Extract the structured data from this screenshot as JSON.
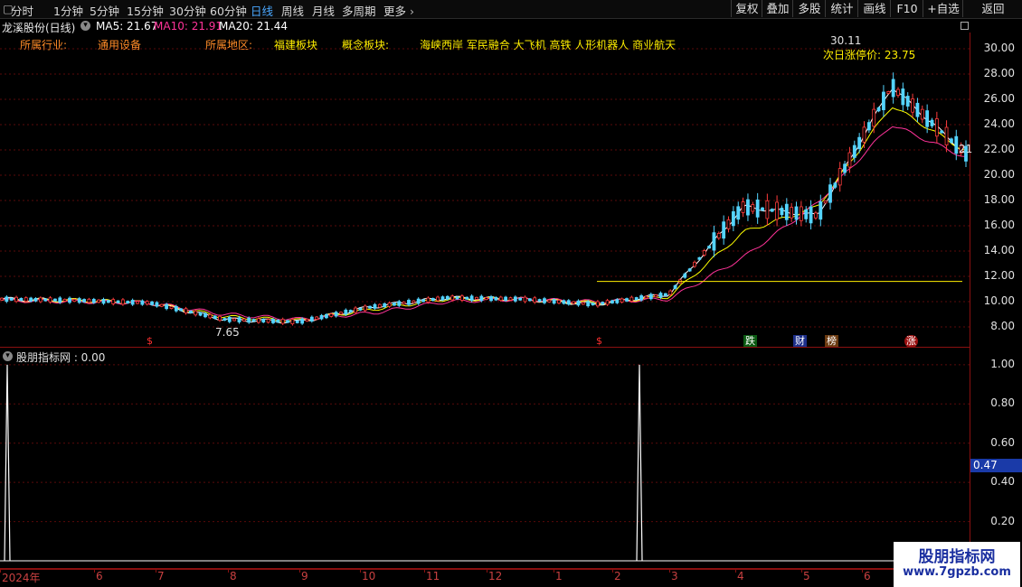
{
  "toolbar": {
    "tabs": [
      "分时",
      "1分钟",
      "5分钟",
      "15分钟",
      "30分钟",
      "60分钟",
      "日线",
      "周线",
      "月线",
      "多周期",
      "更多"
    ],
    "active_tab": "日线",
    "right_buttons": [
      "复权",
      "叠加",
      "多股",
      "统计",
      "画线",
      "F10",
      "+自选",
      "返回"
    ]
  },
  "stock": {
    "name": "龙溪股份(日线)",
    "ma5": "MA5: 21.67",
    "ma10": "MA10: 21.91",
    "ma20": "MA20: 21.44"
  },
  "info": {
    "industry_label": "所属行业:",
    "industry_value": "通用设备",
    "region_label": "所属地区:",
    "region_value": "福建板块",
    "concept_label": "概念板块:",
    "concept_value": "海峡西岸 军民融合 大飞机 高铁 人形机器人 商业航天"
  },
  "annotations": {
    "high": "30.11",
    "limit_up": "次日涨停价: 23.75",
    "low": "7.65",
    "last": "21"
  },
  "price_axis": [
    "30.00",
    "28.00",
    "26.00",
    "24.00",
    "22.00",
    "20.00",
    "18.00",
    "16.00",
    "14.00",
    "12.00",
    "10.00",
    "8.00"
  ],
  "markers": [
    "$",
    "$",
    "跌",
    "财",
    "榜",
    "涨"
  ],
  "indicator": {
    "title": "股朋指标网 : 0.00",
    "axis": [
      "1.00",
      "0.80",
      "0.60",
      "0.40",
      "0.20"
    ],
    "current": "0.47"
  },
  "date_axis": [
    "2024年",
    "6",
    "7",
    "8",
    "9",
    "10",
    "11",
    "12",
    "1",
    "2",
    "3",
    "4",
    "5",
    "6"
  ],
  "watermark": {
    "title": "股朋指标网",
    "url": "www.7gpzb.com"
  },
  "colors": {
    "up": "#ff3c3c",
    "down": "#54d4ff",
    "ma5": "#ffffff",
    "ma10": "#ffff00",
    "ma20": "#ff3399",
    "border": "#8a1010"
  },
  "chart_data": {
    "type": "line",
    "title": "龙溪股份(日线)",
    "x": [
      "2024年",
      "6",
      "7",
      "8",
      "9",
      "10",
      "11",
      "12",
      "1",
      "2",
      "3",
      "4",
      "5",
      "6"
    ],
    "series": [
      {
        "name": "MA5",
        "values": [
          10.2,
          10.1,
          9.9,
          8.6,
          8.4,
          9.6,
          10.3,
          10.2,
          9.8,
          10.6,
          17.5,
          16.8,
          27.0,
          21.7
        ]
      },
      {
        "name": "MA10",
        "values": [
          10.1,
          10.1,
          9.9,
          8.8,
          8.5,
          9.4,
          10.2,
          10.2,
          9.9,
          10.4,
          15.5,
          17.5,
          25.5,
          21.9
        ]
      },
      {
        "name": "MA20",
        "values": [
          10.1,
          10.0,
          9.9,
          9.0,
          8.6,
          9.1,
          10.0,
          10.2,
          10.0,
          10.2,
          13.5,
          17.8,
          24.0,
          21.4
        ]
      }
    ],
    "ylim": [
      7,
      31
    ],
    "annotations": {
      "high": 30.11,
      "low": 7.65,
      "limit_up": 23.75
    },
    "indicator": {
      "name": "股朋指标网",
      "ylim": [
        0,
        1.05
      ],
      "spikes": [
        {
          "x": "2024年",
          "value": 1.0
        },
        {
          "x": "2",
          "value": 1.0
        }
      ],
      "current": 0.0,
      "cursor_value": 0.47
    }
  }
}
